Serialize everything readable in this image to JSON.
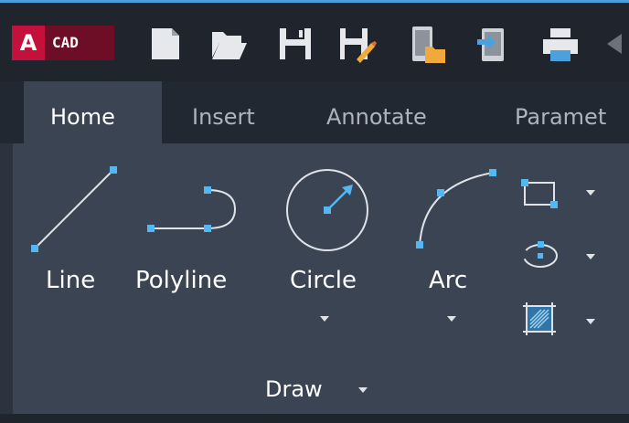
{
  "app": {
    "logo_letter": "A",
    "logo_text": "CAD"
  },
  "quick_access": {
    "icons": [
      "new-file-icon",
      "open-folder-icon",
      "save-icon",
      "save-as-icon",
      "open-from-mobile-icon",
      "import-from-mobile-icon",
      "print-icon",
      "undo-icon"
    ]
  },
  "tabs": [
    "Home",
    "Insert",
    "Annotate",
    "Paramet"
  ],
  "draw": {
    "title": "Draw",
    "tools": {
      "line": "Line",
      "polyline": "Polyline",
      "circle": "Circle",
      "arc": "Arc"
    }
  },
  "colors": {
    "accent": "#4aa1dc",
    "logo_red": "#c4113c",
    "logo_dark_red": "#6d0d26",
    "panel": "#3b4452"
  }
}
